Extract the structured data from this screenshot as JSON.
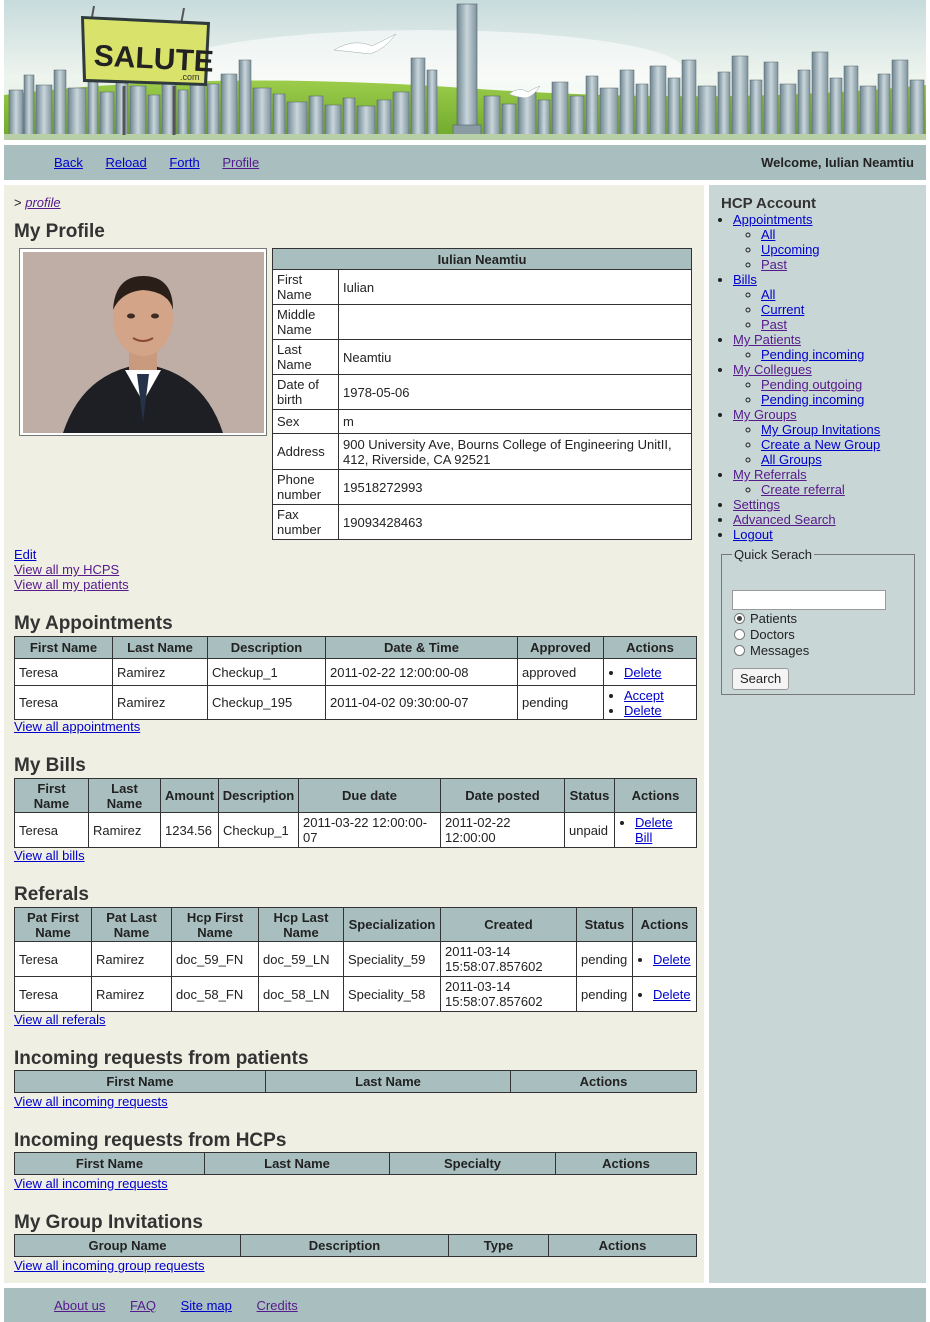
{
  "header": {
    "logo_text": "SALUTE",
    "logo_sub": ".com"
  },
  "topnav": {
    "links": [
      "Back",
      "Reload",
      "Forth",
      "Profile"
    ],
    "welcome": "Welcome, Iulian Neamtiu"
  },
  "breadcrumb": {
    "prefix": ">",
    "link": "profile"
  },
  "profile": {
    "heading": "My Profile",
    "name": "Iulian Neamtiu",
    "fields": [
      {
        "label": "First Name",
        "value": "Iulian"
      },
      {
        "label": "Middle Name",
        "value": ""
      },
      {
        "label": "Last Name",
        "value": "Neamtiu"
      },
      {
        "label": "Date of birth",
        "value": "1978-05-06"
      },
      {
        "label": "Sex",
        "value": "m"
      },
      {
        "label": "Address",
        "value": "900 University Ave, Bourns College of Engineering UnitII, 412, Riverside, CA 92521"
      },
      {
        "label": "Phone number",
        "value": "19518272993"
      },
      {
        "label": "Fax number",
        "value": "19093428463"
      }
    ],
    "links": [
      "Edit",
      "View all my HCPS",
      "View all my patients"
    ]
  },
  "appointments": {
    "heading": "My Appointments",
    "columns": [
      "First Name",
      "Last Name",
      "Description",
      "Date & Time",
      "Approved",
      "Actions"
    ],
    "rows": [
      {
        "first": "Teresa",
        "last": "Ramirez",
        "desc": "Checkup_1",
        "datetime": "2011-02-22 12:00:00-08",
        "approved": "approved",
        "actions": [
          "Delete"
        ]
      },
      {
        "first": "Teresa",
        "last": "Ramirez",
        "desc": "Checkup_195",
        "datetime": "2011-04-02 09:30:00-07",
        "approved": "pending",
        "actions": [
          "Accept",
          "Delete"
        ]
      }
    ],
    "view_all": "View all appointments"
  },
  "bills": {
    "heading": "My Bills",
    "columns": [
      "First Name",
      "Last Name",
      "Amount",
      "Description",
      "Due date",
      "Date posted",
      "Status",
      "Actions"
    ],
    "rows": [
      {
        "first": "Teresa",
        "last": "Ramirez",
        "amount": "1234.56",
        "desc": "Checkup_1",
        "due": "2011-03-22 12:00:00-07",
        "posted": "2011-02-22 12:00:00",
        "status": "unpaid",
        "action": "Delete Bill"
      }
    ],
    "view_all": "View all bills"
  },
  "referals": {
    "heading": "Referals",
    "columns": [
      "Pat First Name",
      "Pat Last Name",
      "Hcp First Name",
      "Hcp Last Name",
      "Specialization",
      "Created",
      "Status",
      "Actions"
    ],
    "rows": [
      {
        "pfirst": "Teresa",
        "plast": "Ramirez",
        "hfirst": "doc_59_FN",
        "hlast": "doc_59_LN",
        "spec": "Speciality_59",
        "created": "2011-03-14 15:58:07.857602",
        "status": "pending",
        "action": "Delete"
      },
      {
        "pfirst": "Teresa",
        "plast": "Ramirez",
        "hfirst": "doc_58_FN",
        "hlast": "doc_58_LN",
        "spec": "Speciality_58",
        "created": "2011-03-14 15:58:07.857602",
        "status": "pending",
        "action": "Delete"
      }
    ],
    "view_all": "View all referals"
  },
  "incoming_patients": {
    "heading": "Incoming requests from patients",
    "columns": [
      "First Name",
      "Last Name",
      "Actions"
    ],
    "view_all": "View all incoming requests"
  },
  "incoming_hcps": {
    "heading": "Incoming requests from HCPs",
    "columns": [
      "First Name",
      "Last Name",
      "Specialty",
      "Actions"
    ],
    "view_all": "View all incoming requests"
  },
  "group_invitations": {
    "heading": "My Group Invitations",
    "columns": [
      "Group Name",
      "Description",
      "Type",
      "Actions"
    ],
    "view_all": "View all incoming group requests"
  },
  "sidebar": {
    "title": "HCP Account",
    "menu": [
      {
        "label": "Appointments",
        "children": [
          "All",
          "Upcoming",
          "Past"
        ]
      },
      {
        "label": "Bills",
        "children": [
          "All",
          "Current",
          "Past"
        ]
      },
      {
        "label": "My Patients",
        "children": [
          "Pending incoming"
        ]
      },
      {
        "label": "My Collegues",
        "children": [
          "Pending outgoing",
          "Pending incoming"
        ]
      },
      {
        "label": "My Groups",
        "children": [
          "My Group Invitations",
          "Create a New Group",
          "All Groups"
        ]
      },
      {
        "label": "My Referrals",
        "children": [
          "Create referral"
        ]
      },
      {
        "label": "Settings",
        "children": []
      },
      {
        "label": "Advanced Search",
        "children": []
      },
      {
        "label": "Logout",
        "children": []
      }
    ],
    "quick_search": {
      "legend": "Quick Serach",
      "value": "",
      "options": [
        "Patients",
        "Doctors",
        "Messages"
      ],
      "selected": "Patients",
      "button": "Search"
    }
  },
  "footer": {
    "links": [
      "About us",
      "FAQ",
      "Site map",
      "Credits"
    ]
  },
  "colors": {
    "nav_bg": "#a9bfbf",
    "main_bg": "#efefe3",
    "sidebar_bg": "#c9d6d6",
    "link": "#0000cc",
    "visited_link": "#551a8b"
  }
}
